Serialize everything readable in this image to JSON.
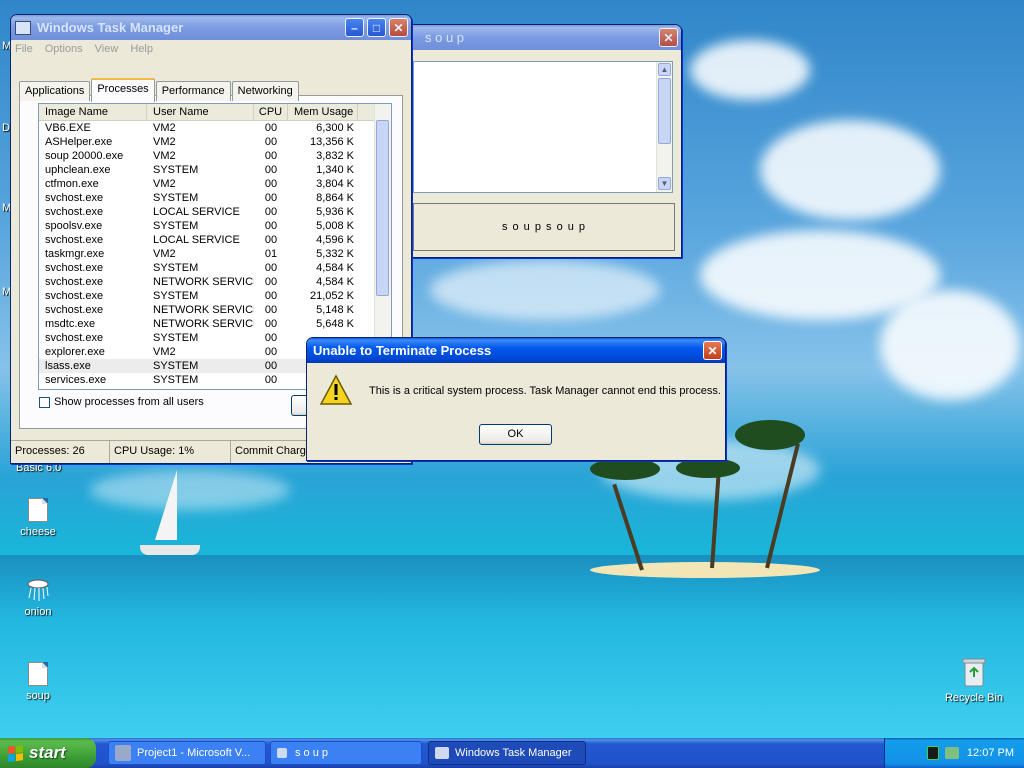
{
  "taskmgr": {
    "title": "Windows Task Manager",
    "menu": [
      "File",
      "Options",
      "View",
      "Help"
    ],
    "tabs": [
      "Applications",
      "Processes",
      "Performance",
      "Networking"
    ],
    "active_tab": "Processes",
    "columns": [
      "Image Name",
      "User Name",
      "CPU",
      "Mem Usage"
    ],
    "rows": [
      [
        "VB6.EXE",
        "VM2",
        "00",
        "6,300 K"
      ],
      [
        "ASHelper.exe",
        "VM2",
        "00",
        "13,356 K"
      ],
      [
        "soup 20000.exe",
        "VM2",
        "00",
        "3,832 K"
      ],
      [
        "uphclean.exe",
        "SYSTEM",
        "00",
        "1,340 K"
      ],
      [
        "ctfmon.exe",
        "VM2",
        "00",
        "3,804 K"
      ],
      [
        "svchost.exe",
        "SYSTEM",
        "00",
        "8,864 K"
      ],
      [
        "svchost.exe",
        "LOCAL SERVICE",
        "00",
        "5,936 K"
      ],
      [
        "spoolsv.exe",
        "SYSTEM",
        "00",
        "5,008 K"
      ],
      [
        "svchost.exe",
        "LOCAL SERVICE",
        "00",
        "4,596 K"
      ],
      [
        "taskmgr.exe",
        "VM2",
        "01",
        "5,332 K"
      ],
      [
        "svchost.exe",
        "SYSTEM",
        "00",
        "4,584 K"
      ],
      [
        "svchost.exe",
        "NETWORK SERVICE",
        "00",
        "4,584 K"
      ],
      [
        "svchost.exe",
        "SYSTEM",
        "00",
        "21,052 K"
      ],
      [
        "svchost.exe",
        "NETWORK SERVICE",
        "00",
        "5,148 K"
      ],
      [
        "msdtc.exe",
        "NETWORK SERVICE",
        "00",
        "5,648 K"
      ],
      [
        "svchost.exe",
        "SYSTEM",
        "00",
        ""
      ],
      [
        "explorer.exe",
        "VM2",
        "00",
        ""
      ],
      [
        "lsass.exe",
        "SYSTEM",
        "00",
        ""
      ],
      [
        "services.exe",
        "SYSTEM",
        "00",
        ""
      ]
    ],
    "selected_row": 17,
    "show_all_label": "Show processes from all users",
    "status": {
      "processes": "Processes: 26",
      "cpu": "CPU Usage: 1%",
      "commit": "Commit Charge"
    }
  },
  "soup_window": {
    "title": "s o u p",
    "button_label": "s o u p s o u p"
  },
  "dialog": {
    "title": "Unable to Terminate Process",
    "message": "This is a critical system process.  Task Manager cannot end this process.",
    "ok_label": "OK"
  },
  "desktop": {
    "basic_label": "Basic 6.0",
    "icons": [
      "cheese",
      "onion",
      "soup",
      "Recycle Bin"
    ]
  },
  "taskbar": {
    "start_label": "start",
    "items": [
      "Project1 - Microsoft V...",
      "s o u p",
      "Windows Task Manager"
    ],
    "active_item": "Windows Task Manager",
    "clock": "12:07 PM"
  },
  "colors": {
    "title_active": "#0058ee",
    "start_green": "#3c9f35",
    "warning_yellow": "#f5d320"
  }
}
